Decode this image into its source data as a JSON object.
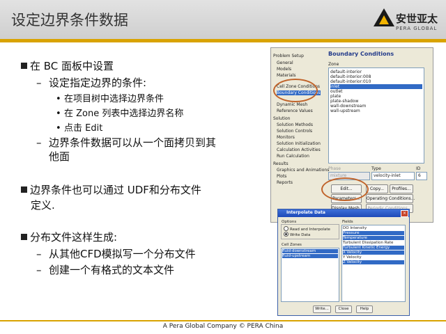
{
  "slide": {
    "title": "设定边界条件数据",
    "logo_cn": "安世亚太",
    "logo_en": "PERA GLOBAL",
    "footer": "A Pera Global Company © PERA China",
    "bullets": {
      "b1": "在 BC 面板中设置",
      "b1_1": "设定指定边界的条件:",
      "b1_1a": "在项目树中选择边界条件",
      "b1_1b": "在 Zone 列表中选择边界名称",
      "b1_1c": "点击 Edit",
      "b1_2a": "边界条件数据可以从一个面拷贝到其",
      "b1_2b": "他面",
      "b2a": "边界条件也可以通过 UDF和分布文件",
      "b2b": "定义.",
      "b3": "分布文件这样生成:",
      "b3_1": "从其他CFD模拟写一个分布文件",
      "b3_2": "创建一个有格式的文本文件"
    }
  },
  "fluent": {
    "tree_header": "Problem Setup",
    "tree": [
      "General",
      "Models",
      "Materials",
      "Cell Zone Conditions",
      "Boundary Conditions",
      "Dynamic Mesh",
      "Reference Values"
    ],
    "solution_header": "Solution",
    "solution": [
      "Solution Methods",
      "Solution Controls",
      "Monitors",
      "Solution Initialization",
      "Calculation Activities",
      "Run Calculation"
    ],
    "results_header": "Results",
    "results": [
      "Graphics and Animations",
      "Plots",
      "Reports"
    ],
    "bc_title": "Boundary Conditions",
    "zone_label": "Zone",
    "zones": [
      "default-interior",
      "default-interior:008",
      "default-interior:010",
      "inlet",
      "outlet",
      "plate",
      "plate-shadow",
      "wall-downstream",
      "wall-upstream"
    ],
    "selected_zone": "inlet",
    "phase_label": "Phase",
    "phase_value": "mixture",
    "type_label": "Type",
    "type_value": "velocity-inlet",
    "id_label": "ID",
    "id_value": "6",
    "buttons": {
      "edit": "Edit...",
      "copy": "Copy...",
      "profiles": "Profiles...",
      "parameters": "Parameters...",
      "operating": "Operating Conditions...",
      "display_mesh": "Display Mesh...",
      "periodic": "Periodic Conditions..."
    },
    "accent": "#c0632a"
  },
  "dialog": {
    "title": "Interpolate Data",
    "options_label": "Options",
    "opt_read": "Read and Interpolate",
    "opt_write": "Write Data",
    "cell_zones_label": "Cell Zones",
    "cell_zones": [
      "fluid-downstream",
      "fluid-upstream"
    ],
    "fields_label": "Fields",
    "fields": [
      {
        "label": "DO Intensity",
        "selected": false
      },
      {
        "label": "Pressure",
        "selected": true
      },
      {
        "label": "Temperature",
        "selected": true
      },
      {
        "label": "Turbulent Dissipation Rate",
        "selected": false
      },
      {
        "label": "Turbulent Kinetic Energy",
        "selected": true
      },
      {
        "label": "X Velocity",
        "selected": true
      },
      {
        "label": "Y Velocity",
        "selected": false
      },
      {
        "label": "Z Velocity",
        "selected": true
      }
    ],
    "buttons": {
      "write": "Write...",
      "close": "Close",
      "help": "Help"
    }
  }
}
